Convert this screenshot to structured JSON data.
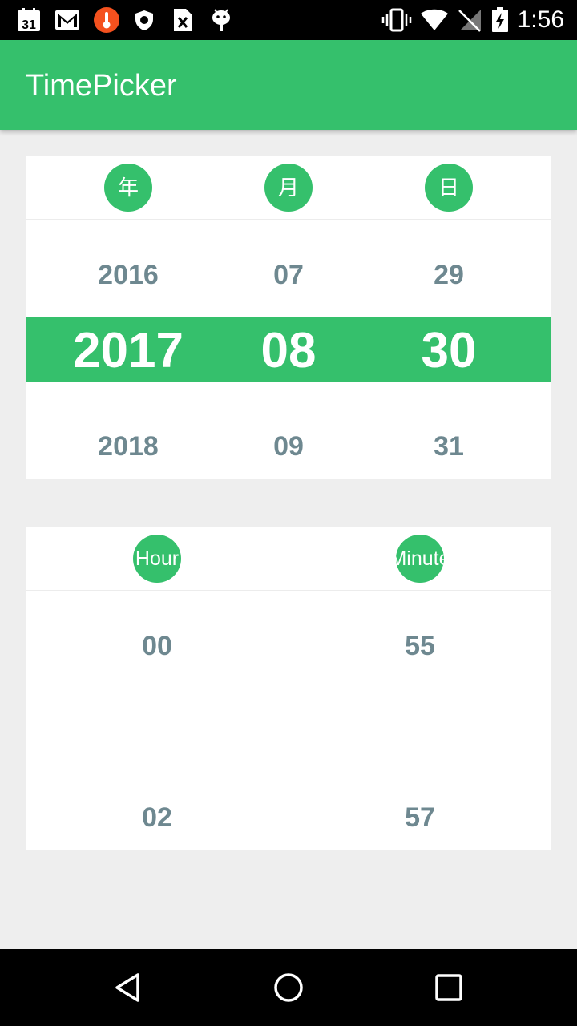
{
  "status_bar": {
    "time": "1:56",
    "left_icons": [
      "calendar-icon",
      "gmail-icon",
      "thermometer-icon",
      "shield-icon",
      "sim-card-icon",
      "android-icon"
    ],
    "calendar_day": "31",
    "right_icons": [
      "vibrate-icon",
      "wifi-icon",
      "no-signal-icon",
      "battery-charging-icon"
    ]
  },
  "app_bar": {
    "title": "TimePicker"
  },
  "date_picker": {
    "headers": {
      "year": "年",
      "month": "月",
      "day": "日"
    },
    "year": {
      "prev": "2016",
      "selected": "2017",
      "next": "2018"
    },
    "month": {
      "prev": "07",
      "selected": "08",
      "next": "09"
    },
    "day": {
      "prev": "29",
      "selected": "30",
      "next": "31"
    }
  },
  "time_picker": {
    "headers": {
      "hour": "Hour",
      "minute": "Minute"
    },
    "hour": {
      "prev": "00",
      "next": "02"
    },
    "minute": {
      "prev": "55",
      "next": "57"
    }
  },
  "nav_bar": {
    "icons": [
      "back-icon",
      "home-icon",
      "recents-icon"
    ]
  },
  "colors": {
    "accent": "#35c06c",
    "number_text": "#6e8890",
    "background": "#eeeeee"
  }
}
